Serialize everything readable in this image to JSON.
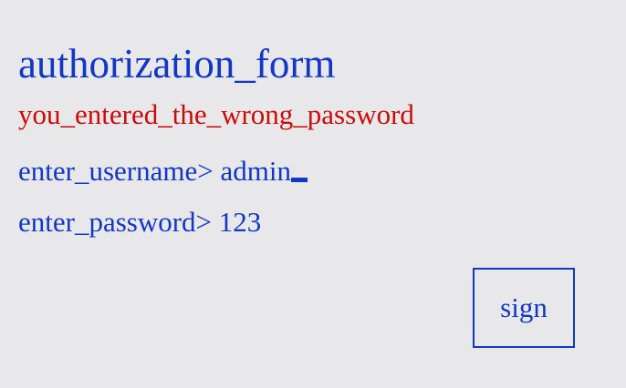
{
  "form": {
    "title": "authorization_form",
    "error_message": "you_entered_the_wrong_password",
    "username_prompt": "enter_username> ",
    "username_value": "admin",
    "password_prompt": "enter_password> ",
    "password_value": "123",
    "sign_label": "sign"
  },
  "colors": {
    "background": "#e8e8ea",
    "text": "#1237c4",
    "error": "#cc0a0a"
  }
}
